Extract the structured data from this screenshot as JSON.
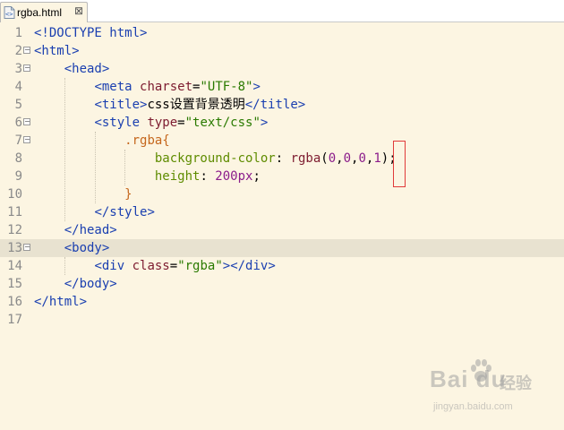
{
  "tab": {
    "filename": "rgba.html",
    "close_glyph": "⊠"
  },
  "lines": [
    {
      "num": "1",
      "fold": false,
      "current": false,
      "tokens": [
        {
          "c": "t-tag",
          "t": "<!DOCTYPE html>"
        }
      ]
    },
    {
      "num": "2",
      "fold": true,
      "current": false,
      "tokens": [
        {
          "c": "t-tag",
          "t": "<html>"
        }
      ]
    },
    {
      "num": "3",
      "fold": true,
      "current": false,
      "tokens": [
        {
          "c": "t-txt",
          "t": "    "
        },
        {
          "c": "t-tag",
          "t": "<head>"
        }
      ]
    },
    {
      "num": "4",
      "fold": false,
      "current": false,
      "tokens": [
        {
          "c": "t-txt",
          "t": "        "
        },
        {
          "c": "t-tag",
          "t": "<meta "
        },
        {
          "c": "t-attr",
          "t": "charset"
        },
        {
          "c": "t-punc",
          "t": "="
        },
        {
          "c": "t-str",
          "t": "\"UTF-8\""
        },
        {
          "c": "t-tag",
          "t": ">"
        }
      ]
    },
    {
      "num": "5",
      "fold": false,
      "current": false,
      "tokens": [
        {
          "c": "t-txt",
          "t": "        "
        },
        {
          "c": "t-tag",
          "t": "<title>"
        },
        {
          "c": "t-txt",
          "t": "css设置背景透明"
        },
        {
          "c": "t-tag",
          "t": "</title>"
        }
      ]
    },
    {
      "num": "6",
      "fold": true,
      "current": false,
      "tokens": [
        {
          "c": "t-txt",
          "t": "        "
        },
        {
          "c": "t-tag",
          "t": "<style "
        },
        {
          "c": "t-attr",
          "t": "type"
        },
        {
          "c": "t-punc",
          "t": "="
        },
        {
          "c": "t-str",
          "t": "\"text/css\""
        },
        {
          "c": "t-tag",
          "t": ">"
        }
      ]
    },
    {
      "num": "7",
      "fold": true,
      "current": false,
      "tokens": [
        {
          "c": "t-txt",
          "t": "            "
        },
        {
          "c": "t-sel",
          "t": ".rgba{"
        }
      ]
    },
    {
      "num": "8",
      "fold": false,
      "current": false,
      "tokens": [
        {
          "c": "t-txt",
          "t": "                "
        },
        {
          "c": "t-prop",
          "t": "background-color"
        },
        {
          "c": "t-punc",
          "t": ": "
        },
        {
          "c": "t-attr",
          "t": "rgba"
        },
        {
          "c": "t-punc",
          "t": "("
        },
        {
          "c": "t-num",
          "t": "0"
        },
        {
          "c": "t-punc",
          "t": ","
        },
        {
          "c": "t-num",
          "t": "0"
        },
        {
          "c": "t-punc",
          "t": ","
        },
        {
          "c": "t-num",
          "t": "0"
        },
        {
          "c": "t-punc",
          "t": ","
        },
        {
          "c": "t-num",
          "t": "1"
        },
        {
          "c": "t-punc",
          "t": ");"
        }
      ]
    },
    {
      "num": "9",
      "fold": false,
      "current": false,
      "tokens": [
        {
          "c": "t-txt",
          "t": "                "
        },
        {
          "c": "t-prop",
          "t": "height"
        },
        {
          "c": "t-punc",
          "t": ": "
        },
        {
          "c": "t-num",
          "t": "200px"
        },
        {
          "c": "t-punc",
          "t": ";"
        }
      ]
    },
    {
      "num": "10",
      "fold": false,
      "current": false,
      "tokens": [
        {
          "c": "t-txt",
          "t": "            "
        },
        {
          "c": "t-sel",
          "t": "}"
        }
      ]
    },
    {
      "num": "11",
      "fold": false,
      "current": false,
      "tokens": [
        {
          "c": "t-txt",
          "t": "        "
        },
        {
          "c": "t-tag",
          "t": "</style>"
        }
      ]
    },
    {
      "num": "12",
      "fold": false,
      "current": false,
      "tokens": [
        {
          "c": "t-txt",
          "t": "    "
        },
        {
          "c": "t-tag",
          "t": "</head>"
        }
      ]
    },
    {
      "num": "13",
      "fold": true,
      "current": true,
      "tokens": [
        {
          "c": "t-txt",
          "t": "    "
        },
        {
          "c": "t-tag",
          "t": "<body>"
        }
      ]
    },
    {
      "num": "14",
      "fold": false,
      "current": false,
      "tokens": [
        {
          "c": "t-txt",
          "t": "        "
        },
        {
          "c": "t-tag",
          "t": "<div "
        },
        {
          "c": "t-attr",
          "t": "class"
        },
        {
          "c": "t-punc",
          "t": "="
        },
        {
          "c": "t-str",
          "t": "\"rgba\""
        },
        {
          "c": "t-tag",
          "t": "></div>"
        }
      ]
    },
    {
      "num": "15",
      "fold": false,
      "current": false,
      "tokens": [
        {
          "c": "t-txt",
          "t": "    "
        },
        {
          "c": "t-tag",
          "t": "</body>"
        }
      ]
    },
    {
      "num": "16",
      "fold": false,
      "current": false,
      "tokens": [
        {
          "c": "t-tag",
          "t": "</html>"
        }
      ]
    },
    {
      "num": "17",
      "fold": false,
      "current": false,
      "tokens": []
    }
  ],
  "watermark": {
    "logo": "Bai du",
    "cn": "经验",
    "url": "jingyan.baidu.com"
  }
}
